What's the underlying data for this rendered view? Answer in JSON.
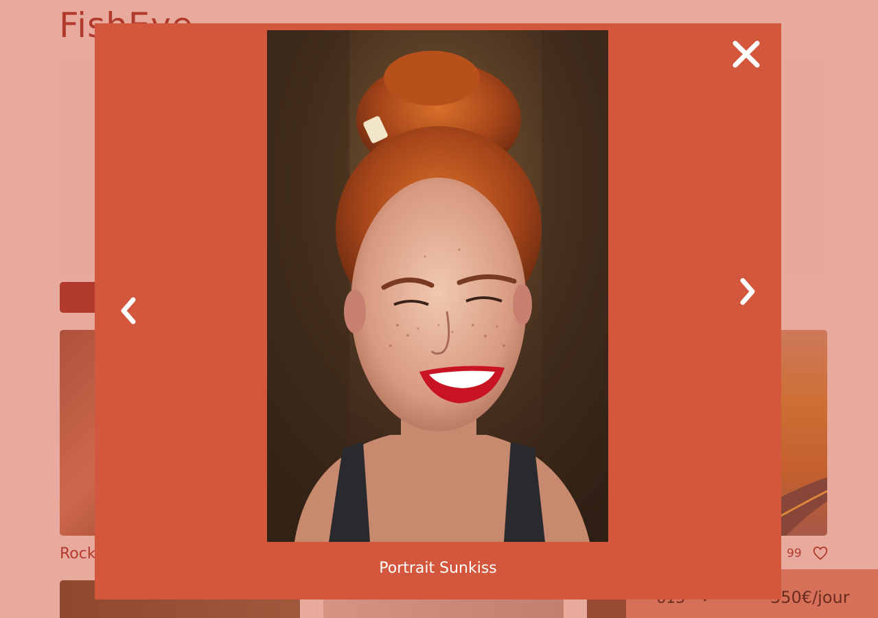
{
  "background": {
    "logo": "FishEye",
    "card_title": "Rock",
    "card_likes": "99",
    "stats": {
      "likes_label": "613",
      "price_label": "350€/jour"
    },
    "colors": {
      "brand_dark": "#901c1c",
      "brand_accent": "#d3573c",
      "stats_bg": "#db8876"
    }
  },
  "lightbox": {
    "caption": "Portrait Sunkiss",
    "close_icon": "close-x-icon",
    "prev_icon": "chevron-left-icon",
    "next_icon": "chevron-right-icon",
    "colors": {
      "panel": "#d3573c",
      "icons": "#ffffff"
    }
  }
}
